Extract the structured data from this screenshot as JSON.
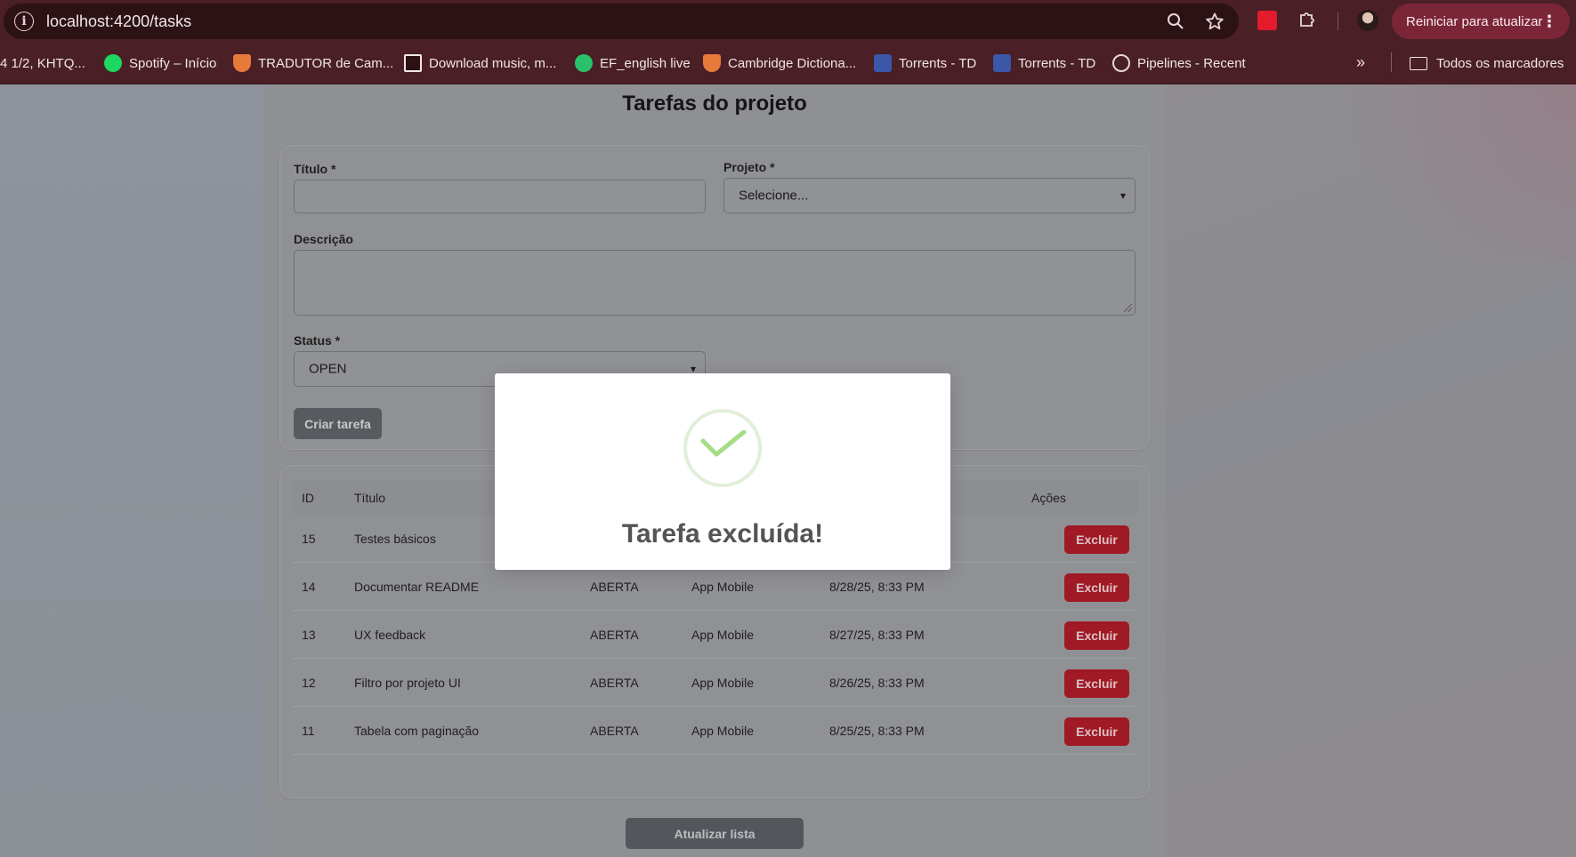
{
  "browser": {
    "url": "localhost:4200/tasks",
    "update_button": "Reiniciar para atualizar",
    "bookmarks": [
      {
        "label": "4 1/2, KHTQ...",
        "icon": "page-icon",
        "color": "#e8d7d9"
      },
      {
        "label": "Spotify – Início",
        "icon": "spotify-icon",
        "color": "#1ed760"
      },
      {
        "label": "TRADUTOR de Cam...",
        "icon": "cambridge-shield-icon",
        "color": "#e7793b"
      },
      {
        "label": "Download music, m...",
        "icon": "download-icon",
        "color": "#f1e6e7"
      },
      {
        "label": "EF_english live",
        "icon": "ef-icon",
        "color": "#29c16b"
      },
      {
        "label": "Cambridge Dictiona...",
        "icon": "cambridge-shield-icon",
        "color": "#e7793b"
      },
      {
        "label": "Torrents - TD",
        "icon": "td-icon",
        "color": "#3a57a8"
      },
      {
        "label": "Torrents - TD",
        "icon": "td-icon",
        "color": "#3a57a8"
      },
      {
        "label": "Pipelines - Recent",
        "icon": "globe-icon",
        "color": "#e8d7d9"
      }
    ],
    "all_bookmarks": "Todos os marcadores"
  },
  "page": {
    "title": "Tarefas do projeto",
    "form": {
      "title_label": "Título *",
      "title_value": "",
      "project_label": "Projeto *",
      "project_value": "Selecione...",
      "description_label": "Descrição",
      "description_value": "",
      "status_label": "Status *",
      "status_value": "OPEN",
      "create_button": "Criar tarefa"
    },
    "table": {
      "headers": {
        "id": "ID",
        "title": "Título",
        "actions": "Ações"
      },
      "delete_label": "Excluir",
      "rows": [
        {
          "id": "15",
          "title": "Testes básicos",
          "status": "",
          "project": "",
          "date": ""
        },
        {
          "id": "14",
          "title": "Documentar README",
          "status": "ABERTA",
          "project": "App Mobile",
          "date": "8/28/25, 8:33 PM"
        },
        {
          "id": "13",
          "title": "UX feedback",
          "status": "ABERTA",
          "project": "App Mobile",
          "date": "8/27/25, 8:33 PM"
        },
        {
          "id": "12",
          "title": "Filtro por projeto UI",
          "status": "ABERTA",
          "project": "App Mobile",
          "date": "8/26/25, 8:33 PM"
        },
        {
          "id": "11",
          "title": "Tabela com paginação",
          "status": "ABERTA",
          "project": "App Mobile",
          "date": "8/25/25, 8:33 PM"
        }
      ]
    },
    "refresh_button": "Atualizar lista"
  },
  "modal": {
    "title": "Tarefa excluída!",
    "icon": "success-check-icon",
    "accent": "#a5dc86"
  },
  "colors": {
    "danger": "#a01a25",
    "chrome": "#4a1f26"
  }
}
